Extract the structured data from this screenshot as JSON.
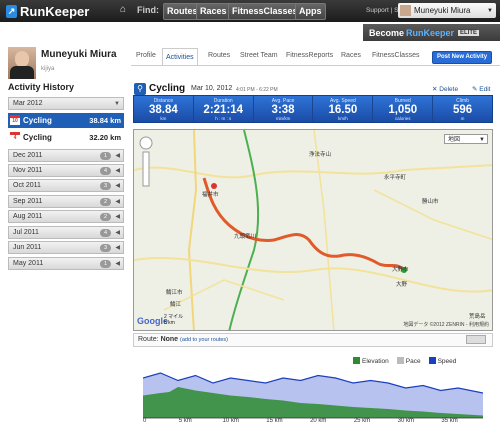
{
  "app": {
    "logo_text": "RunKeeper",
    "nav": {
      "find_label": "Find:",
      "buttons": [
        "Routes",
        "Races",
        "FitnessClasses",
        "Apps"
      ]
    },
    "support_link": "Support | Store",
    "user_name": "Muneyuki Miura",
    "elite_banner": {
      "prefix": "Become",
      "brand": "RunKeeper",
      "badge": "ELITE"
    }
  },
  "profile": {
    "name": "Muneyuki Miura",
    "subtitle": "kijiya"
  },
  "tabs": [
    "Profile",
    "Activities",
    "Routes",
    "Street Team",
    "FitnessReports",
    "Races",
    "FitnessClasses"
  ],
  "active_tab": "Activities",
  "new_activity_label": "Post New Activity",
  "sidebar": {
    "title": "Activity History",
    "current_month": "Mar 2012",
    "activities": [
      {
        "day": "10",
        "name": "Cycling",
        "distance": "38.84 km",
        "selected": true
      },
      {
        "day": "4",
        "name": "Cycling",
        "distance": "32.20 km",
        "selected": false
      }
    ],
    "months": [
      {
        "label": "Dec 2011",
        "count": "1"
      },
      {
        "label": "Nov 2011",
        "count": "4"
      },
      {
        "label": "Oct 2011",
        "count": "3"
      },
      {
        "label": "Sep 2011",
        "count": "2"
      },
      {
        "label": "Aug 2011",
        "count": "2"
      },
      {
        "label": "Jul 2011",
        "count": "4"
      },
      {
        "label": "Jun 2011",
        "count": "3"
      },
      {
        "label": "May 2011",
        "count": "1"
      }
    ]
  },
  "activity": {
    "type": "Cycling",
    "date": "Mar 10, 2012",
    "time_range": "4:01 PM - 6:22 PM",
    "delete_label": "Delete",
    "edit_label": "Edit",
    "stats": [
      {
        "label": "Distance",
        "value": "38.84",
        "unit": "km"
      },
      {
        "label": "Duration",
        "value": "2:21:14",
        "unit": "h : m : s"
      },
      {
        "label": "Avg. Pace",
        "value": "3:38",
        "unit": "min/km"
      },
      {
        "label": "Avg. Speed",
        "value": "16.50",
        "unit": "km/h"
      },
      {
        "label": "Burned",
        "value": "1,050",
        "unit": "calories"
      },
      {
        "label": "Climb",
        "value": "596",
        "unit": "m"
      }
    ]
  },
  "map": {
    "type_selector": "地図",
    "labels": [
      "浄法寺山",
      "福井市",
      "永平寺町",
      "勝山市",
      "大野市",
      "鯖江市",
      "九頭竜川",
      "荒島岳",
      "大野",
      "鯖江"
    ],
    "google": "Google",
    "scale_text": "2 マイル",
    "scale_km": "5 km",
    "copyright": "地図データ ©2012 ZENRIN - 利用規約"
  },
  "route": {
    "label": "Route:",
    "value": "None",
    "add_link": "(add to your routes)"
  },
  "chart_data": {
    "type": "area",
    "xlabel": "",
    "ylabel": "",
    "x_ticks": [
      "0",
      "5 km",
      "10 km",
      "15 km",
      "20 km",
      "25 km",
      "30 km",
      "35 km"
    ],
    "xlim": [
      0,
      38.84
    ],
    "series": [
      {
        "name": "Elevation",
        "color": "#2e8b2e",
        "x": [
          0,
          2,
          3,
          4,
          6,
          8,
          10,
          12,
          14,
          16,
          18,
          20,
          22,
          24,
          26,
          28,
          30,
          32,
          34,
          36,
          38.84
        ],
        "values": [
          0.45,
          0.5,
          0.52,
          0.62,
          0.55,
          0.5,
          0.45,
          0.42,
          0.38,
          0.35,
          0.3,
          0.28,
          0.25,
          0.22,
          0.2,
          0.18,
          0.15,
          0.13,
          0.1,
          0.08,
          0.05
        ]
      },
      {
        "name": "Pace",
        "color": "#bbbbbb",
        "x": [],
        "values": []
      },
      {
        "name": "Speed",
        "color": "#1a3fbf",
        "x": [
          0,
          2,
          4,
          6,
          8,
          10,
          12,
          14,
          16,
          18,
          20,
          22,
          24,
          26,
          28,
          30,
          32,
          34,
          36,
          38.84
        ],
        "values": [
          0.8,
          0.9,
          0.75,
          0.85,
          0.7,
          0.8,
          0.75,
          0.7,
          0.8,
          0.75,
          0.85,
          0.8,
          0.7,
          0.75,
          0.7,
          0.6,
          0.65,
          0.55,
          0.6,
          0.5
        ]
      }
    ]
  }
}
